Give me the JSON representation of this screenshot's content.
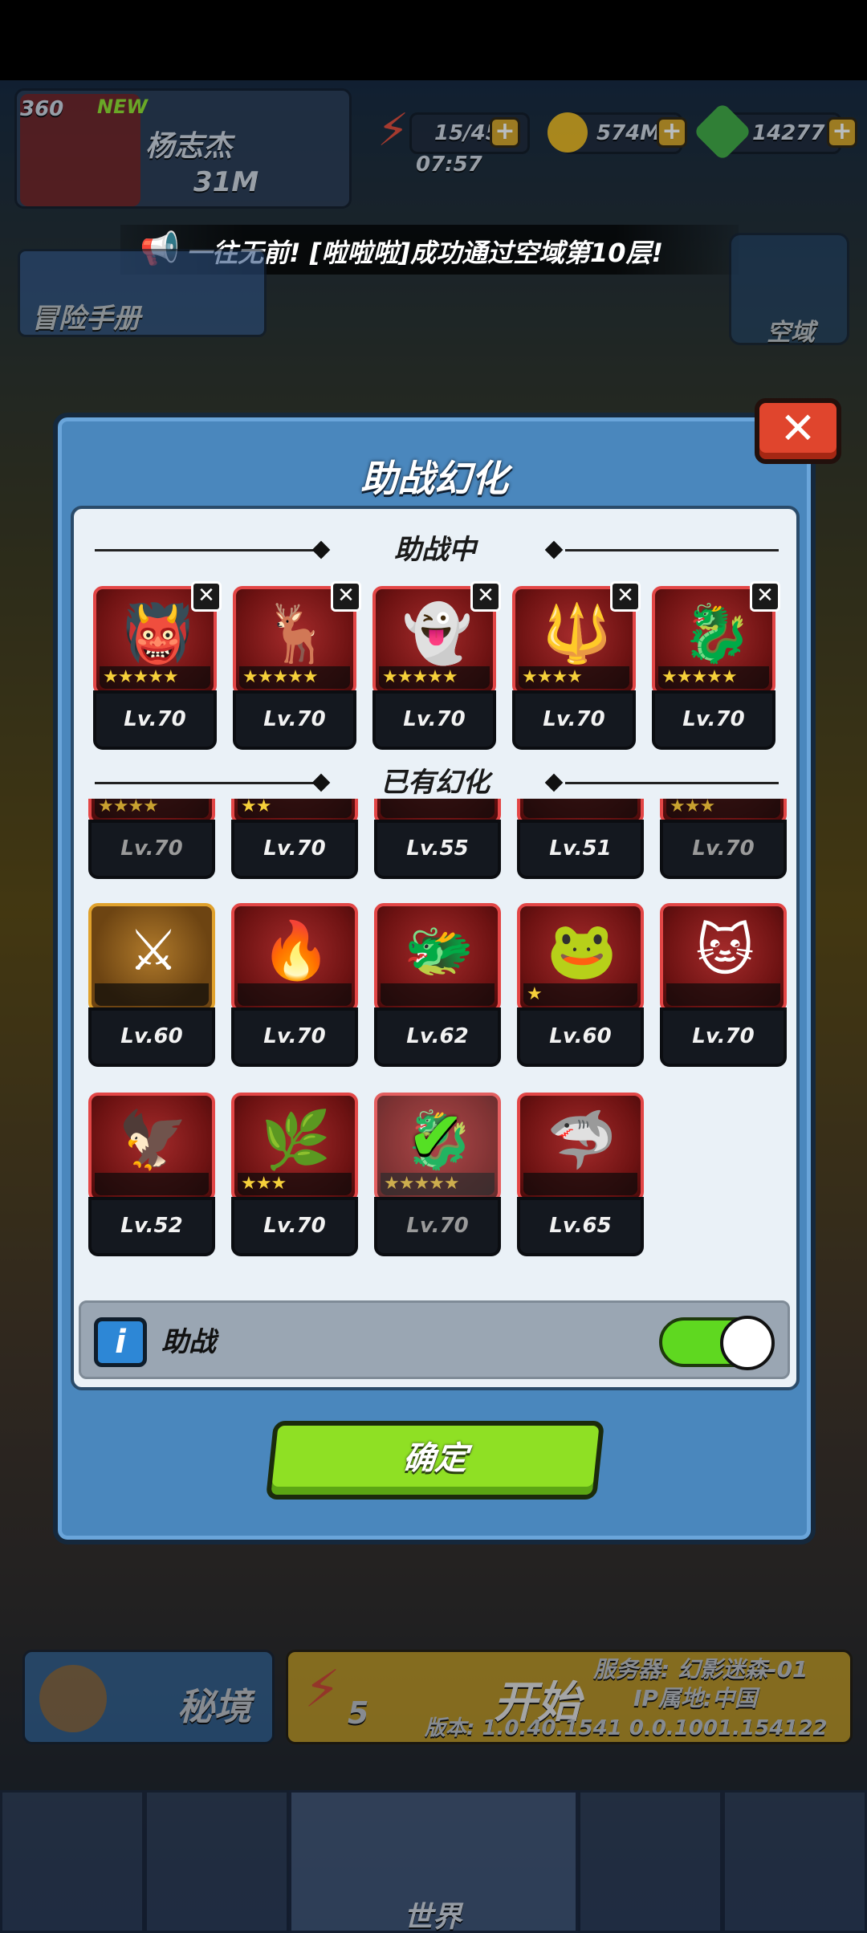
{
  "player": {
    "level": "360",
    "new_badge": "NEW",
    "name": "杨志杰",
    "power": "31M"
  },
  "resources": {
    "energy": "15/45",
    "energy_timer": "07:57",
    "gold": "574M",
    "gems": "14277"
  },
  "announcement": "一往无前! [啦啦啦]成功通过空域第10层!",
  "side": {
    "adventure_book": "冒险手册",
    "sky_domain": "空域"
  },
  "dialog": {
    "title": "助战幻化",
    "close_label": "✕",
    "section_active": "助战中",
    "section_owned": "已有幻化",
    "active": [
      {
        "level": "Lv.70",
        "stars": "★★★★★",
        "remove": "✕"
      },
      {
        "level": "Lv.70",
        "stars": "★★★★★",
        "remove": "✕"
      },
      {
        "level": "Lv.70",
        "stars": "★★★★★",
        "remove": "✕"
      },
      {
        "level": "Lv.70",
        "stars": "★★★★",
        "remove": "✕"
      },
      {
        "level": "Lv.70",
        "stars": "★★★★★",
        "remove": "✕"
      }
    ],
    "owned_row1": [
      {
        "level": "Lv.70",
        "stars": "★★★★"
      },
      {
        "level": "Lv.70",
        "stars": "★★"
      },
      {
        "level": "Lv.55",
        "stars": ""
      },
      {
        "level": "Lv.51",
        "stars": ""
      },
      {
        "level": "Lv.70",
        "stars": "★★★"
      }
    ],
    "owned_row2": [
      {
        "level": "Lv.60",
        "stars": ""
      },
      {
        "level": "Lv.70",
        "stars": ""
      },
      {
        "level": "Lv.62",
        "stars": ""
      },
      {
        "level": "Lv.60",
        "stars": "★"
      },
      {
        "level": "Lv.70",
        "stars": ""
      }
    ],
    "owned_row3": [
      {
        "level": "Lv.52",
        "stars": ""
      },
      {
        "level": "Lv.70",
        "stars": "★★★"
      },
      {
        "level": "Lv.70",
        "stars": "★★★★★",
        "selected": "✔"
      },
      {
        "level": "Lv.65",
        "stars": ""
      }
    ],
    "info_icon": "i",
    "assist_label": "助战",
    "assist_toggle": "on",
    "confirm_label": "确定"
  },
  "bottom": {
    "secret_realm": "秘境",
    "start": "开始",
    "start_cost": "5",
    "server": "服务器: 幻影迷森-01",
    "ip": "IP属地:中国",
    "version": "版本: 1.0.40.1541 0.0.1001.154122",
    "world_tab": "世界"
  },
  "colors": {
    "accent_green": "#8fe024",
    "card_border": "#e24646",
    "dialog_blue": "#4a87bd"
  }
}
